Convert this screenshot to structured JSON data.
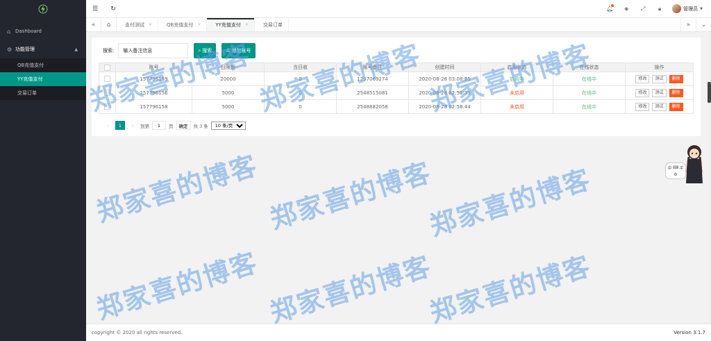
{
  "sidebar": {
    "logo_icon": "lightning-circle-icon",
    "dashboard_label": "Dashboard",
    "group_label": "功能管理",
    "items": [
      {
        "label": "QB充值支付"
      },
      {
        "label": "YY充值支付",
        "active": true
      },
      {
        "label": "交易订单"
      }
    ]
  },
  "topbar": {
    "user_name": "管理员"
  },
  "tabs": [
    {
      "label": "支付测试"
    },
    {
      "label": "QB充值支付"
    },
    {
      "label": "YY充值支付",
      "active": true
    },
    {
      "label": "交易订单"
    }
  ],
  "search": {
    "label": "搜索:",
    "placeholder": "输入备注信息",
    "search_button": "搜索",
    "add_button": "增加账号"
  },
  "table": {
    "headers": [
      "账号",
      "日限额",
      "当日收",
      "账号备注",
      "创建时间",
      "启用状态",
      "在线状态",
      "操作"
    ],
    "rows": [
      {
        "account": "157796159",
        "limit": "20000",
        "today": "0",
        "remark": "1237069274",
        "created": "2020-08-28 03:08:25",
        "enabled": "启用中",
        "enabled_color": "#5fb878",
        "online": "在线中"
      },
      {
        "account": "157796156",
        "limit": "5000",
        "today": "0",
        "remark": "2548515081",
        "created": "2020-08-28 02:55:39",
        "enabled": "未启用",
        "enabled_color": "#ff5722",
        "online": "在线中"
      },
      {
        "account": "157796158",
        "limit": "5000",
        "today": "0",
        "remark": "2548882058",
        "created": "2020-08-28 02:58:44",
        "enabled": "未启用",
        "enabled_color": "#ff5722",
        "online": "在线中"
      }
    ],
    "op_edit": "修改",
    "op_test": "测试",
    "op_delete": "删除"
  },
  "pager": {
    "current": "1",
    "goto_label": "到第",
    "goto_value": "1",
    "page_unit": "页",
    "confirm": "确定",
    "total": "共 3 条",
    "page_size": "10 条/页"
  },
  "watermark": "郑家喜的博客",
  "mascot": {
    "buttons": [
      "中",
      "⌨",
      "半",
      "⚙"
    ]
  },
  "footer": {
    "copyright": "copyright © 2020 all rights reserved.",
    "version": "Version 3.1.7"
  },
  "colors": {
    "accent": "#009688",
    "sidebar_bg": "#23262e",
    "danger": "#ff5722",
    "success": "#5fb878"
  }
}
